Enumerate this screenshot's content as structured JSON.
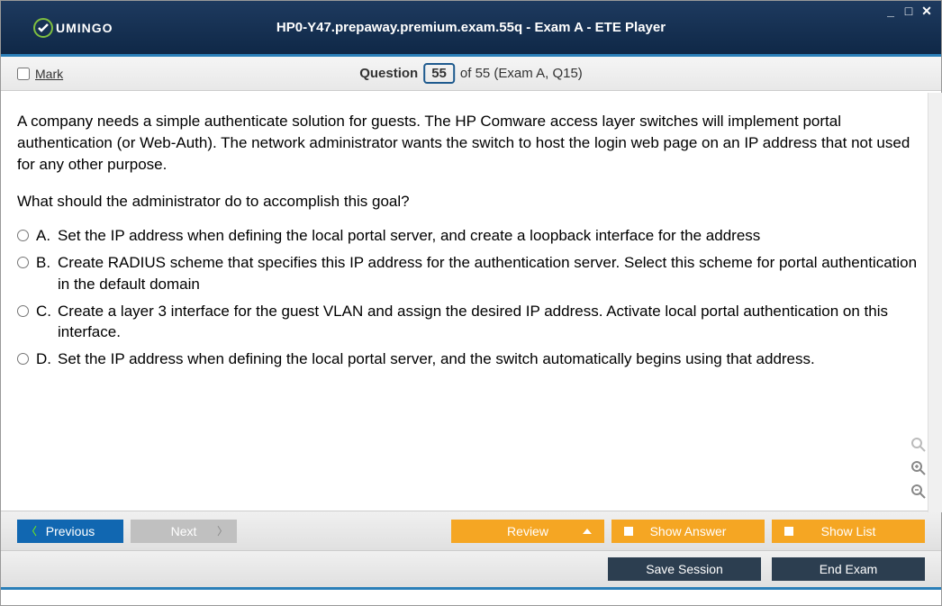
{
  "window": {
    "title": "HP0-Y47.prepaway.premium.exam.55q - Exam A - ETE Player",
    "logo_text": "UMINGO"
  },
  "subbar": {
    "mark_label": "Mark",
    "question_word": "Question",
    "current_num": "55",
    "of_text": "of 55 (Exam A, Q15)"
  },
  "question": {
    "text": "A company needs a simple authenticate solution for guests. The HP Comware access layer switches will implement portal authentication (or Web-Auth). The network administrator wants the switch to host the login web page on an IP address that not used for any other purpose.",
    "prompt": "What should the administrator do to accomplish this goal?",
    "options": [
      {
        "letter": "A.",
        "text": "Set the IP address when defining the local portal server, and create a loopback interface for the address"
      },
      {
        "letter": "B.",
        "text": "Create RADIUS scheme that specifies this IP address for the authentication server. Select this scheme for portal authentication in the default domain"
      },
      {
        "letter": "C.",
        "text": "Create a layer 3 interface for the guest VLAN and assign the desired IP address. Activate local portal authentication on this interface."
      },
      {
        "letter": "D.",
        "text": "Set the IP address when defining the local portal server, and the switch automatically begins using that address."
      }
    ]
  },
  "buttons": {
    "previous": "Previous",
    "next": "Next",
    "review": "Review",
    "show_answer": "Show Answer",
    "show_list": "Show List",
    "save_session": "Save Session",
    "end_exam": "End Exam"
  }
}
